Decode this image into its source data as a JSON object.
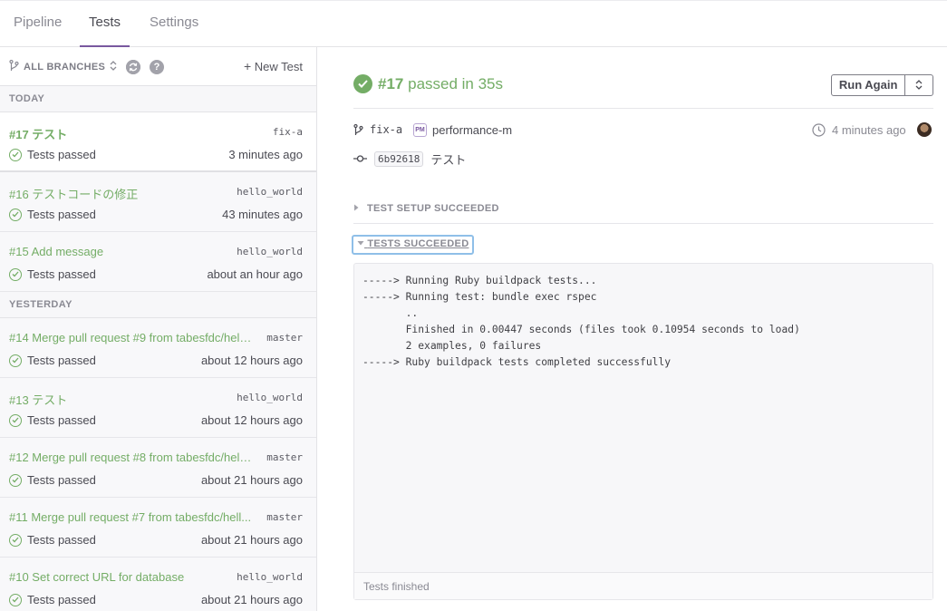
{
  "nav": {
    "tabs": [
      "Pipeline",
      "Tests",
      "Settings"
    ],
    "active": "Tests"
  },
  "sidebar": {
    "branch_selector": "ALL BRANCHES",
    "help": "?",
    "new_test": "New Test",
    "sections": [
      {
        "label": "TODAY"
      },
      {
        "label": "YESTERDAY"
      }
    ],
    "runs": [
      {
        "title": "#17 テスト",
        "branch": "fix-a",
        "status": "Tests passed",
        "time": "3 minutes ago"
      },
      {
        "title": "#16 テストコードの修正",
        "branch": "hello_world",
        "status": "Tests passed",
        "time": "43 minutes ago"
      },
      {
        "title": "#15 Add message",
        "branch": "hello_world",
        "status": "Tests passed",
        "time": "about an hour ago"
      },
      {
        "title": "#14 Merge pull request #9 from tabesfdc/hell...",
        "branch": "master",
        "status": "Tests passed",
        "time": "about 12 hours ago"
      },
      {
        "title": "#13 テスト",
        "branch": "hello_world",
        "status": "Tests passed",
        "time": "about 12 hours ago"
      },
      {
        "title": "#12 Merge pull request #8 from tabesfdc/hell...",
        "branch": "master",
        "status": "Tests passed",
        "time": "about 21 hours ago"
      },
      {
        "title": "#11 Merge pull request #7 from tabesfdc/hell...",
        "branch": "master",
        "status": "Tests passed",
        "time": "about 21 hours ago"
      },
      {
        "title": "#10 Set correct URL for database",
        "branch": "hello_world",
        "status": "Tests passed",
        "time": "about 21 hours ago"
      }
    ]
  },
  "main": {
    "run_number": "#17",
    "result_text": "passed in 35s",
    "run_again": "Run Again",
    "branch": "fix-a",
    "pm_badge": "PM",
    "pipeline": "performance-m",
    "time_ago": "4 minutes ago",
    "commit_sha": "6b92618",
    "commit_message": "テスト",
    "setup_label": "TEST SETUP SUCCEEDED",
    "tests_label": "TESTS SUCCEEDED",
    "log_lines": [
      "-----> Running Ruby buildpack tests...",
      "-----> Running test: bundle exec rspec",
      "       ..",
      "       Finished in 0.00447 seconds (files took 0.10954 seconds to load)",
      "       2 examples, 0 failures",
      "-----> Ruby buildpack tests completed successfully"
    ],
    "log_footer": "Tests finished"
  },
  "colors": {
    "accent_purple": "#79589f",
    "success_green": "#74ad66",
    "focus_blue": "#8fbfe8"
  }
}
